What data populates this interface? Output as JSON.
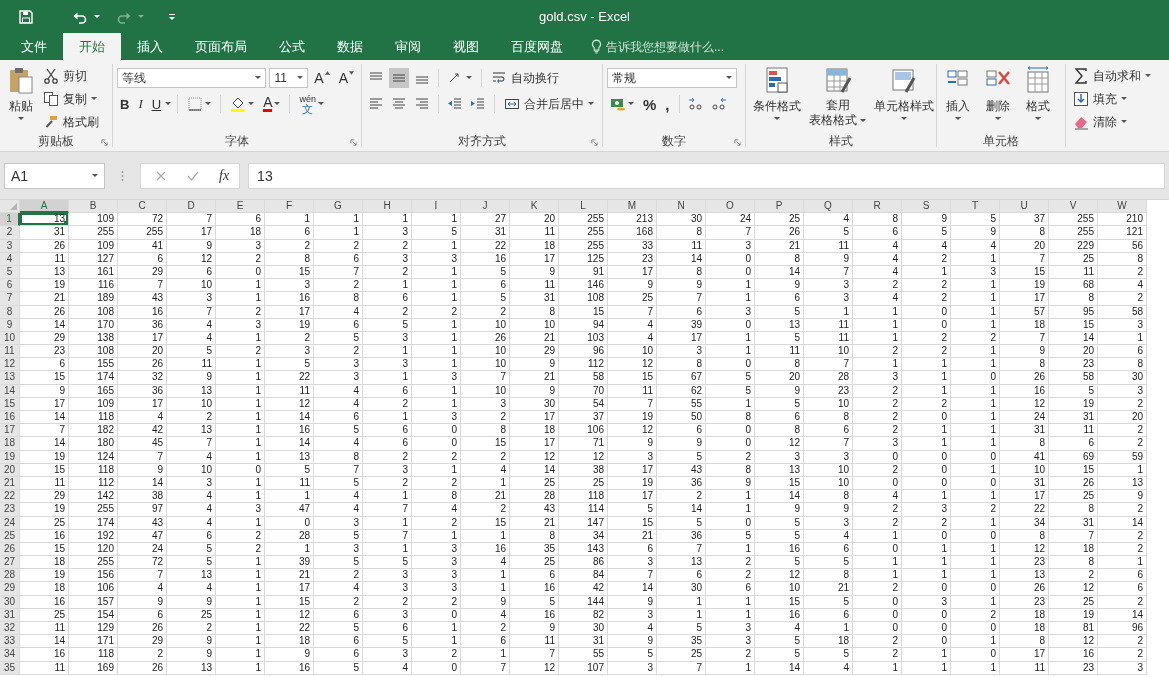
{
  "window": {
    "title": "gold.csv - Excel"
  },
  "menu_tabs": [
    {
      "label": "文件",
      "selected": false
    },
    {
      "label": "开始",
      "selected": true
    },
    {
      "label": "插入",
      "selected": false
    },
    {
      "label": "页面布局",
      "selected": false
    },
    {
      "label": "公式",
      "selected": false
    },
    {
      "label": "数据",
      "selected": false
    },
    {
      "label": "审阅",
      "selected": false
    },
    {
      "label": "视图",
      "selected": false
    },
    {
      "label": "百度网盘",
      "selected": false
    }
  ],
  "tell_me": {
    "placeholder": "告诉我您想要做什么..."
  },
  "clipboard": {
    "label": "剪贴板",
    "paste": "粘贴",
    "cut": "剪切",
    "copy": "复制",
    "format_painter": "格式刷"
  },
  "font": {
    "label": "字体",
    "font_name": "等线",
    "font_size": "11",
    "grow": "A",
    "shrink": "A",
    "bold": "B",
    "italic": "I",
    "underline": "U",
    "font_color": "A",
    "phonetic_top": "wén",
    "phonetic_bottom": "文"
  },
  "alignment": {
    "label": "对齐方式",
    "wrap_text": "自动换行",
    "merge_center": "合并后居中"
  },
  "number": {
    "label": "数字",
    "format": "常规",
    "percent": "%",
    "comma": ","
  },
  "styles": {
    "label": "样式",
    "conditional": "条件格式",
    "table_line1": "套用",
    "table_line2": "表格格式",
    "cell_styles": "单元格样式"
  },
  "cells": {
    "label": "单元格",
    "insert": "插入",
    "delete": "删除",
    "format": "格式"
  },
  "editing": {
    "autosum": "自动求和",
    "fill": "填充",
    "clear": "清除"
  },
  "formula_bar": {
    "name_box": "A1",
    "fx": "fx",
    "value": "13"
  },
  "sheet": {
    "columns": [
      {
        "label": "A",
        "selected": true
      },
      {
        "label": "B",
        "selected": false
      },
      {
        "label": "C",
        "selected": false
      },
      {
        "label": "D",
        "selected": false
      },
      {
        "label": "E",
        "selected": false
      },
      {
        "label": "F",
        "selected": false
      },
      {
        "label": "G",
        "selected": false
      },
      {
        "label": "H",
        "selected": false
      },
      {
        "label": "I",
        "selected": false
      },
      {
        "label": "J",
        "selected": false
      },
      {
        "label": "K",
        "selected": false
      },
      {
        "label": "L",
        "selected": false
      },
      {
        "label": "M",
        "selected": false
      },
      {
        "label": "N",
        "selected": false
      },
      {
        "label": "O",
        "selected": false
      },
      {
        "label": "P",
        "selected": false
      },
      {
        "label": "Q",
        "selected": false
      },
      {
        "label": "R",
        "selected": false
      },
      {
        "label": "S",
        "selected": false
      },
      {
        "label": "T",
        "selected": false
      },
      {
        "label": "U",
        "selected": false
      },
      {
        "label": "V",
        "selected": false
      },
      {
        "label": "W",
        "selected": false
      }
    ],
    "rows": [
      {
        "header": "1",
        "selected": true,
        "cells": [
          "13",
          "109",
          "72",
          "7",
          "6",
          "1",
          "1",
          "1",
          "1",
          "27",
          "20",
          "255",
          "213",
          "30",
          "24",
          "25",
          "4",
          "8",
          "9",
          "5",
          "37",
          "255",
          "210"
        ]
      },
      {
        "header": "2",
        "selected": false,
        "cells": [
          "31",
          "255",
          "255",
          "17",
          "18",
          "6",
          "1",
          "3",
          "5",
          "31",
          "11",
          "255",
          "168",
          "8",
          "7",
          "26",
          "5",
          "6",
          "5",
          "9",
          "8",
          "255",
          "121"
        ]
      },
      {
        "header": "3",
        "selected": false,
        "cells": [
          "26",
          "109",
          "41",
          "9",
          "3",
          "2",
          "2",
          "2",
          "1",
          "22",
          "18",
          "255",
          "33",
          "11",
          "3",
          "21",
          "11",
          "4",
          "4",
          "4",
          "20",
          "229",
          "56"
        ]
      },
      {
        "header": "4",
        "selected": false,
        "cells": [
          "11",
          "127",
          "6",
          "12",
          "2",
          "8",
          "6",
          "3",
          "3",
          "16",
          "17",
          "125",
          "23",
          "14",
          "0",
          "8",
          "9",
          "4",
          "2",
          "1",
          "7",
          "25",
          "8"
        ]
      },
      {
        "header": "5",
        "selected": false,
        "cells": [
          "13",
          "161",
          "29",
          "6",
          "0",
          "15",
          "7",
          "2",
          "1",
          "5",
          "9",
          "91",
          "17",
          "8",
          "0",
          "14",
          "7",
          "4",
          "1",
          "3",
          "15",
          "11",
          "2"
        ]
      },
      {
        "header": "6",
        "selected": false,
        "cells": [
          "19",
          "116",
          "7",
          "10",
          "1",
          "3",
          "2",
          "1",
          "1",
          "6",
          "11",
          "146",
          "9",
          "9",
          "1",
          "9",
          "3",
          "2",
          "2",
          "1",
          "19",
          "68",
          "4"
        ]
      },
      {
        "header": "7",
        "selected": false,
        "cells": [
          "21",
          "189",
          "43",
          "3",
          "1",
          "16",
          "8",
          "6",
          "1",
          "5",
          "31",
          "108",
          "25",
          "7",
          "1",
          "6",
          "3",
          "4",
          "2",
          "1",
          "17",
          "8",
          "2"
        ]
      },
      {
        "header": "8",
        "selected": false,
        "cells": [
          "26",
          "108",
          "16",
          "7",
          "2",
          "17",
          "4",
          "2",
          "2",
          "2",
          "8",
          "15",
          "7",
          "6",
          "3",
          "5",
          "1",
          "1",
          "0",
          "1",
          "57",
          "95",
          "58"
        ]
      },
      {
        "header": "9",
        "selected": false,
        "cells": [
          "14",
          "170",
          "36",
          "4",
          "3",
          "19",
          "6",
          "5",
          "1",
          "10",
          "10",
          "94",
          "4",
          "39",
          "0",
          "13",
          "11",
          "1",
          "0",
          "1",
          "18",
          "15",
          "3"
        ]
      },
      {
        "header": "10",
        "selected": false,
        "cells": [
          "29",
          "138",
          "17",
          "4",
          "1",
          "2",
          "5",
          "3",
          "1",
          "26",
          "21",
          "103",
          "4",
          "17",
          "1",
          "5",
          "11",
          "1",
          "2",
          "2",
          "7",
          "14",
          "1"
        ]
      },
      {
        "header": "11",
        "selected": false,
        "cells": [
          "23",
          "108",
          "20",
          "5",
          "2",
          "3",
          "2",
          "1",
          "1",
          "10",
          "29",
          "96",
          "10",
          "3",
          "1",
          "11",
          "10",
          "2",
          "2",
          "1",
          "9",
          "20",
          "6"
        ]
      },
      {
        "header": "12",
        "selected": false,
        "cells": [
          "6",
          "155",
          "26",
          "11",
          "1",
          "5",
          "3",
          "3",
          "1",
          "10",
          "9",
          "112",
          "12",
          "8",
          "0",
          "8",
          "7",
          "1",
          "1",
          "1",
          "8",
          "23",
          "8"
        ]
      },
      {
        "header": "13",
        "selected": false,
        "cells": [
          "15",
          "174",
          "32",
          "9",
          "1",
          "22",
          "3",
          "1",
          "3",
          "7",
          "21",
          "58",
          "15",
          "67",
          "5",
          "20",
          "28",
          "3",
          "1",
          "0",
          "26",
          "58",
          "30"
        ]
      },
      {
        "header": "14",
        "selected": false,
        "cells": [
          "9",
          "165",
          "36",
          "13",
          "1",
          "11",
          "4",
          "6",
          "1",
          "10",
          "9",
          "70",
          "11",
          "62",
          "5",
          "9",
          "23",
          "2",
          "1",
          "1",
          "16",
          "5",
          "3"
        ]
      },
      {
        "header": "15",
        "selected": false,
        "cells": [
          "17",
          "109",
          "17",
          "10",
          "1",
          "12",
          "4",
          "2",
          "1",
          "3",
          "30",
          "54",
          "7",
          "55",
          "1",
          "5",
          "10",
          "2",
          "2",
          "1",
          "12",
          "19",
          "2"
        ]
      },
      {
        "header": "16",
        "selected": false,
        "cells": [
          "14",
          "118",
          "4",
          "2",
          "1",
          "14",
          "6",
          "1",
          "3",
          "2",
          "17",
          "37",
          "19",
          "50",
          "8",
          "6",
          "8",
          "2",
          "0",
          "1",
          "24",
          "31",
          "20"
        ]
      },
      {
        "header": "17",
        "selected": false,
        "cells": [
          "7",
          "182",
          "42",
          "13",
          "1",
          "16",
          "5",
          "6",
          "0",
          "8",
          "18",
          "106",
          "12",
          "6",
          "0",
          "8",
          "6",
          "2",
          "1",
          "1",
          "31",
          "11",
          "2"
        ]
      },
      {
        "header": "18",
        "selected": false,
        "cells": [
          "14",
          "180",
          "45",
          "7",
          "1",
          "14",
          "4",
          "6",
          "0",
          "15",
          "17",
          "71",
          "9",
          "9",
          "0",
          "12",
          "7",
          "3",
          "1",
          "1",
          "8",
          "6",
          "2"
        ]
      },
      {
        "header": "19",
        "selected": false,
        "cells": [
          "19",
          "124",
          "7",
          "4",
          "1",
          "13",
          "8",
          "2",
          "2",
          "2",
          "12",
          "12",
          "3",
          "5",
          "2",
          "3",
          "3",
          "0",
          "0",
          "0",
          "41",
          "69",
          "59"
        ]
      },
      {
        "header": "20",
        "selected": false,
        "cells": [
          "15",
          "118",
          "9",
          "10",
          "0",
          "5",
          "7",
          "3",
          "1",
          "4",
          "14",
          "38",
          "17",
          "43",
          "8",
          "13",
          "10",
          "2",
          "0",
          "1",
          "10",
          "15",
          "1"
        ]
      },
      {
        "header": "21",
        "selected": false,
        "cells": [
          "11",
          "112",
          "14",
          "3",
          "1",
          "11",
          "5",
          "2",
          "2",
          "1",
          "25",
          "25",
          "19",
          "36",
          "9",
          "15",
          "10",
          "0",
          "0",
          "0",
          "31",
          "26",
          "13"
        ]
      },
      {
        "header": "22",
        "selected": false,
        "cells": [
          "29",
          "142",
          "38",
          "4",
          "1",
          "1",
          "4",
          "1",
          "8",
          "21",
          "28",
          "118",
          "17",
          "2",
          "1",
          "14",
          "8",
          "4",
          "1",
          "1",
          "17",
          "25",
          "9"
        ]
      },
      {
        "header": "23",
        "selected": false,
        "cells": [
          "19",
          "255",
          "97",
          "4",
          "3",
          "47",
          "4",
          "7",
          "4",
          "2",
          "43",
          "114",
          "5",
          "14",
          "1",
          "9",
          "9",
          "2",
          "3",
          "2",
          "22",
          "8",
          "2"
        ]
      },
      {
        "header": "24",
        "selected": false,
        "cells": [
          "25",
          "174",
          "43",
          "4",
          "1",
          "0",
          "3",
          "1",
          "2",
          "15",
          "21",
          "147",
          "15",
          "5",
          "0",
          "5",
          "3",
          "2",
          "2",
          "1",
          "34",
          "31",
          "14"
        ]
      },
      {
        "header": "25",
        "selected": false,
        "cells": [
          "16",
          "192",
          "47",
          "6",
          "2",
          "28",
          "5",
          "7",
          "1",
          "1",
          "8",
          "34",
          "21",
          "36",
          "5",
          "5",
          "4",
          "1",
          "0",
          "0",
          "8",
          "7",
          "2"
        ]
      },
      {
        "header": "26",
        "selected": false,
        "cells": [
          "15",
          "120",
          "24",
          "5",
          "2",
          "1",
          "3",
          "1",
          "3",
          "16",
          "35",
          "143",
          "6",
          "7",
          "1",
          "16",
          "6",
          "0",
          "1",
          "1",
          "12",
          "18",
          "2"
        ]
      },
      {
        "header": "27",
        "selected": false,
        "cells": [
          "18",
          "255",
          "72",
          "5",
          "1",
          "39",
          "5",
          "5",
          "3",
          "4",
          "25",
          "86",
          "3",
          "13",
          "2",
          "5",
          "5",
          "1",
          "1",
          "1",
          "23",
          "8",
          "1"
        ]
      },
      {
        "header": "28",
        "selected": false,
        "cells": [
          "19",
          "156",
          "7",
          "13",
          "1",
          "21",
          "2",
          "3",
          "3",
          "1",
          "6",
          "84",
          "7",
          "6",
          "2",
          "12",
          "8",
          "1",
          "1",
          "1",
          "13",
          "2",
          "6"
        ]
      },
      {
        "header": "29",
        "selected": false,
        "cells": [
          "18",
          "106",
          "4",
          "4",
          "1",
          "17",
          "4",
          "3",
          "3",
          "1",
          "16",
          "42",
          "14",
          "30",
          "6",
          "10",
          "21",
          "2",
          "0",
          "0",
          "26",
          "12",
          "6"
        ]
      },
      {
        "header": "30",
        "selected": false,
        "cells": [
          "16",
          "157",
          "9",
          "9",
          "1",
          "15",
          "2",
          "2",
          "2",
          "9",
          "5",
          "144",
          "9",
          "1",
          "1",
          "15",
          "5",
          "0",
          "3",
          "1",
          "23",
          "25",
          "2"
        ]
      },
      {
        "header": "31",
        "selected": false,
        "cells": [
          "25",
          "154",
          "6",
          "25",
          "1",
          "12",
          "6",
          "3",
          "0",
          "4",
          "16",
          "82",
          "3",
          "1",
          "1",
          "16",
          "6",
          "0",
          "0",
          "2",
          "18",
          "19",
          "14"
        ]
      },
      {
        "header": "32",
        "selected": false,
        "cells": [
          "11",
          "129",
          "26",
          "2",
          "1",
          "22",
          "5",
          "6",
          "1",
          "2",
          "9",
          "30",
          "4",
          "5",
          "3",
          "4",
          "1",
          "0",
          "0",
          "0",
          "18",
          "81",
          "96"
        ]
      },
      {
        "header": "33",
        "selected": false,
        "cells": [
          "14",
          "171",
          "29",
          "9",
          "1",
          "18",
          "6",
          "5",
          "1",
          "6",
          "11",
          "31",
          "9",
          "35",
          "3",
          "5",
          "18",
          "2",
          "0",
          "1",
          "8",
          "12",
          "2"
        ]
      },
      {
        "header": "34",
        "selected": false,
        "cells": [
          "16",
          "118",
          "2",
          "9",
          "1",
          "9",
          "6",
          "3",
          "2",
          "1",
          "7",
          "55",
          "5",
          "25",
          "2",
          "5",
          "5",
          "2",
          "1",
          "0",
          "17",
          "16",
          "2"
        ]
      },
      {
        "header": "35",
        "selected": false,
        "cells": [
          "11",
          "169",
          "26",
          "13",
          "1",
          "16",
          "5",
          "4",
          "0",
          "7",
          "12",
          "107",
          "3",
          "7",
          "1",
          "14",
          "4",
          "1",
          "1",
          "1",
          "11",
          "23",
          "3"
        ]
      }
    ]
  }
}
